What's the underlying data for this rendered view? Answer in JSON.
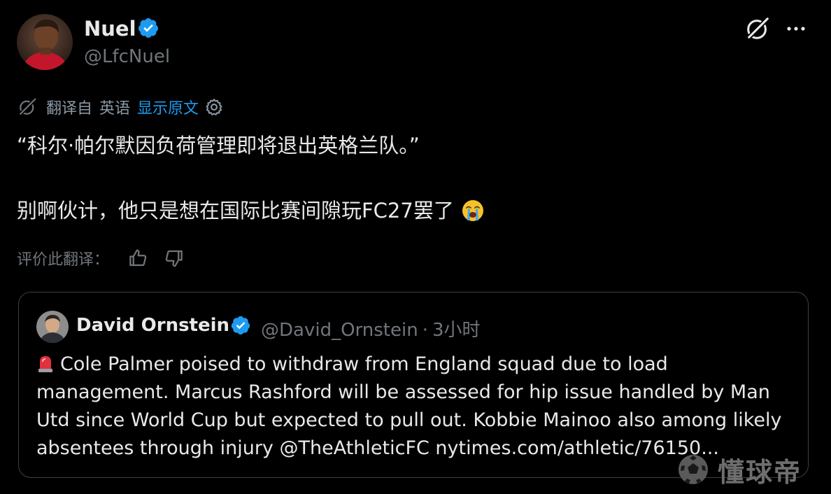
{
  "author": {
    "name": "Nuel",
    "handle": "@LfcNuel",
    "avatar_icon": "profile-photo",
    "verified_color": "#1d9bf0"
  },
  "header_actions": {
    "grok_icon": "grok-icon",
    "more_icon": "more-icon"
  },
  "translation": {
    "prefix": "翻译自",
    "language": "英语",
    "show_original": "显示原文",
    "settings_icon": "gear-icon"
  },
  "tweet": {
    "line1": "“科尔·帕尔默因负荷管理即将退出英格兰队。”",
    "line2": "别啊伙计，他只是想在国际比赛间隙玩FC27罢了",
    "emoji": "loudly-crying-face"
  },
  "rate": {
    "label": "评价此翻译：",
    "like_icon": "thumbs-up-icon",
    "dislike_icon": "thumbs-down-icon"
  },
  "quote": {
    "name": "David Ornstein",
    "handle": "@David_Ornstein",
    "separator": "·",
    "time": "3小时",
    "siren_icon": "rotating-light",
    "lines": [
      "Cole Palmer poised to withdraw from England squad due to load",
      "management. Marcus Rashford will be assessed for hip issue handled by Man",
      "Utd since World Cup but expected to pull out. Kobbie Mainoo also among likely",
      "absentees through injury @TheAthleticFC nytimes.com/athletic/76150..."
    ]
  },
  "watermark": {
    "text": "懂球帝",
    "logo_icon": "soccer-ball-icon"
  },
  "colors": {
    "background": "#000000",
    "text": "#e7e9ea",
    "muted": "#71767b",
    "link": "#1d9bf0",
    "border": "#3b4046"
  }
}
